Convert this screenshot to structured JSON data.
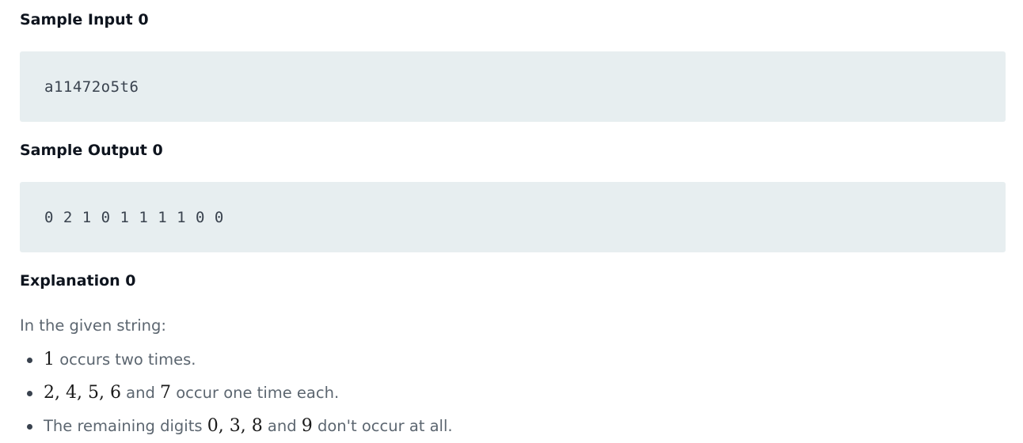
{
  "sample_input": {
    "title": "Sample Input 0",
    "code": "a11472o5t6"
  },
  "sample_output": {
    "title": "Sample Output 0",
    "code": "0 2 1 0 1 1 1 1 0 0"
  },
  "explanation": {
    "title": "Explanation 0",
    "intro": "In the given string:",
    "bullets": [
      {
        "math1": "1",
        "text1": " occurs two times."
      },
      {
        "math1": "2, 4, 5, 6",
        "text1": " and ",
        "math2": "7",
        "text2": " occur one time each."
      },
      {
        "text0": "The remaining digits ",
        "math1": "0, 3, 8",
        "text1": " and ",
        "math2": "9",
        "text2": " don't occur at all."
      }
    ]
  },
  "colors": {
    "code_background": "#e7eef0",
    "heading_text": "#0e141e",
    "body_text": "#5c6670"
  }
}
